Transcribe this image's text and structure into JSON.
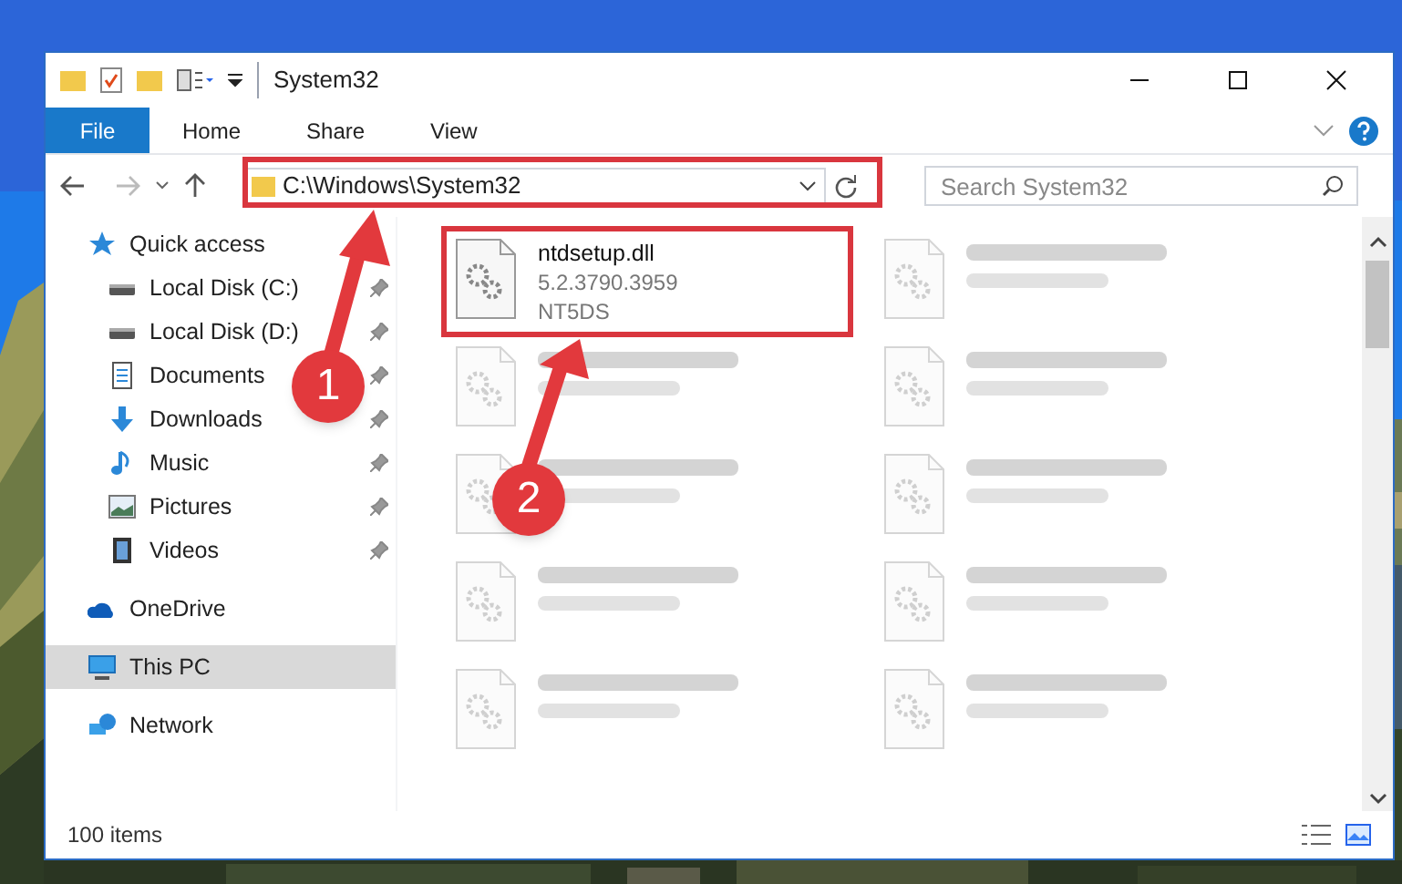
{
  "window": {
    "title": "System32"
  },
  "ribbon": {
    "file_button": "File",
    "tabs": [
      {
        "label": "Home",
        "selected": false
      },
      {
        "label": "Share",
        "selected": false
      },
      {
        "label": "View",
        "selected": false
      }
    ]
  },
  "address_bar": {
    "value": "C:\\Windows\\System32"
  },
  "search": {
    "placeholder": "Search System32"
  },
  "sidebar": {
    "items": [
      {
        "label": "Quick access",
        "kind": "star",
        "selected": false,
        "children": [
          {
            "label": "Local Disk (C:)",
            "kind": "drive",
            "pinned": true,
            "selected": false
          },
          {
            "label": "Local Disk (D:)",
            "kind": "drive",
            "pinned": true,
            "selected": false
          },
          {
            "label": "Documents",
            "kind": "document",
            "pinned": true,
            "selected": false
          },
          {
            "label": "Downloads",
            "kind": "download",
            "pinned": true,
            "selected": false
          },
          {
            "label": "Music",
            "kind": "music",
            "pinned": true,
            "selected": false
          },
          {
            "label": "Pictures",
            "kind": "pictures",
            "pinned": true,
            "selected": false
          },
          {
            "label": "Videos",
            "kind": "video",
            "pinned": true,
            "selected": false
          }
        ]
      },
      {
        "label": "OneDrive",
        "kind": "cloud",
        "selected": false
      },
      {
        "label": "This PC",
        "kind": "monitor",
        "selected": true
      },
      {
        "label": "Network",
        "kind": "network",
        "selected": false
      }
    ]
  },
  "files": [
    {
      "kind": "file",
      "name": "ntdsetup.dll",
      "details": [
        "5.2.3790.3959",
        "NT5DS"
      ]
    },
    {
      "kind": "blurred"
    },
    {
      "kind": "blurred"
    },
    {
      "kind": "blurred"
    },
    {
      "kind": "blurred"
    },
    {
      "kind": "blurred"
    },
    {
      "kind": "blurred"
    },
    {
      "kind": "blurred"
    },
    {
      "kind": "blurred"
    },
    {
      "kind": "blurred"
    }
  ],
  "status_bar": {
    "text": "100 items"
  },
  "annotations": [
    {
      "number": "1"
    },
    {
      "number": "2"
    }
  ]
}
